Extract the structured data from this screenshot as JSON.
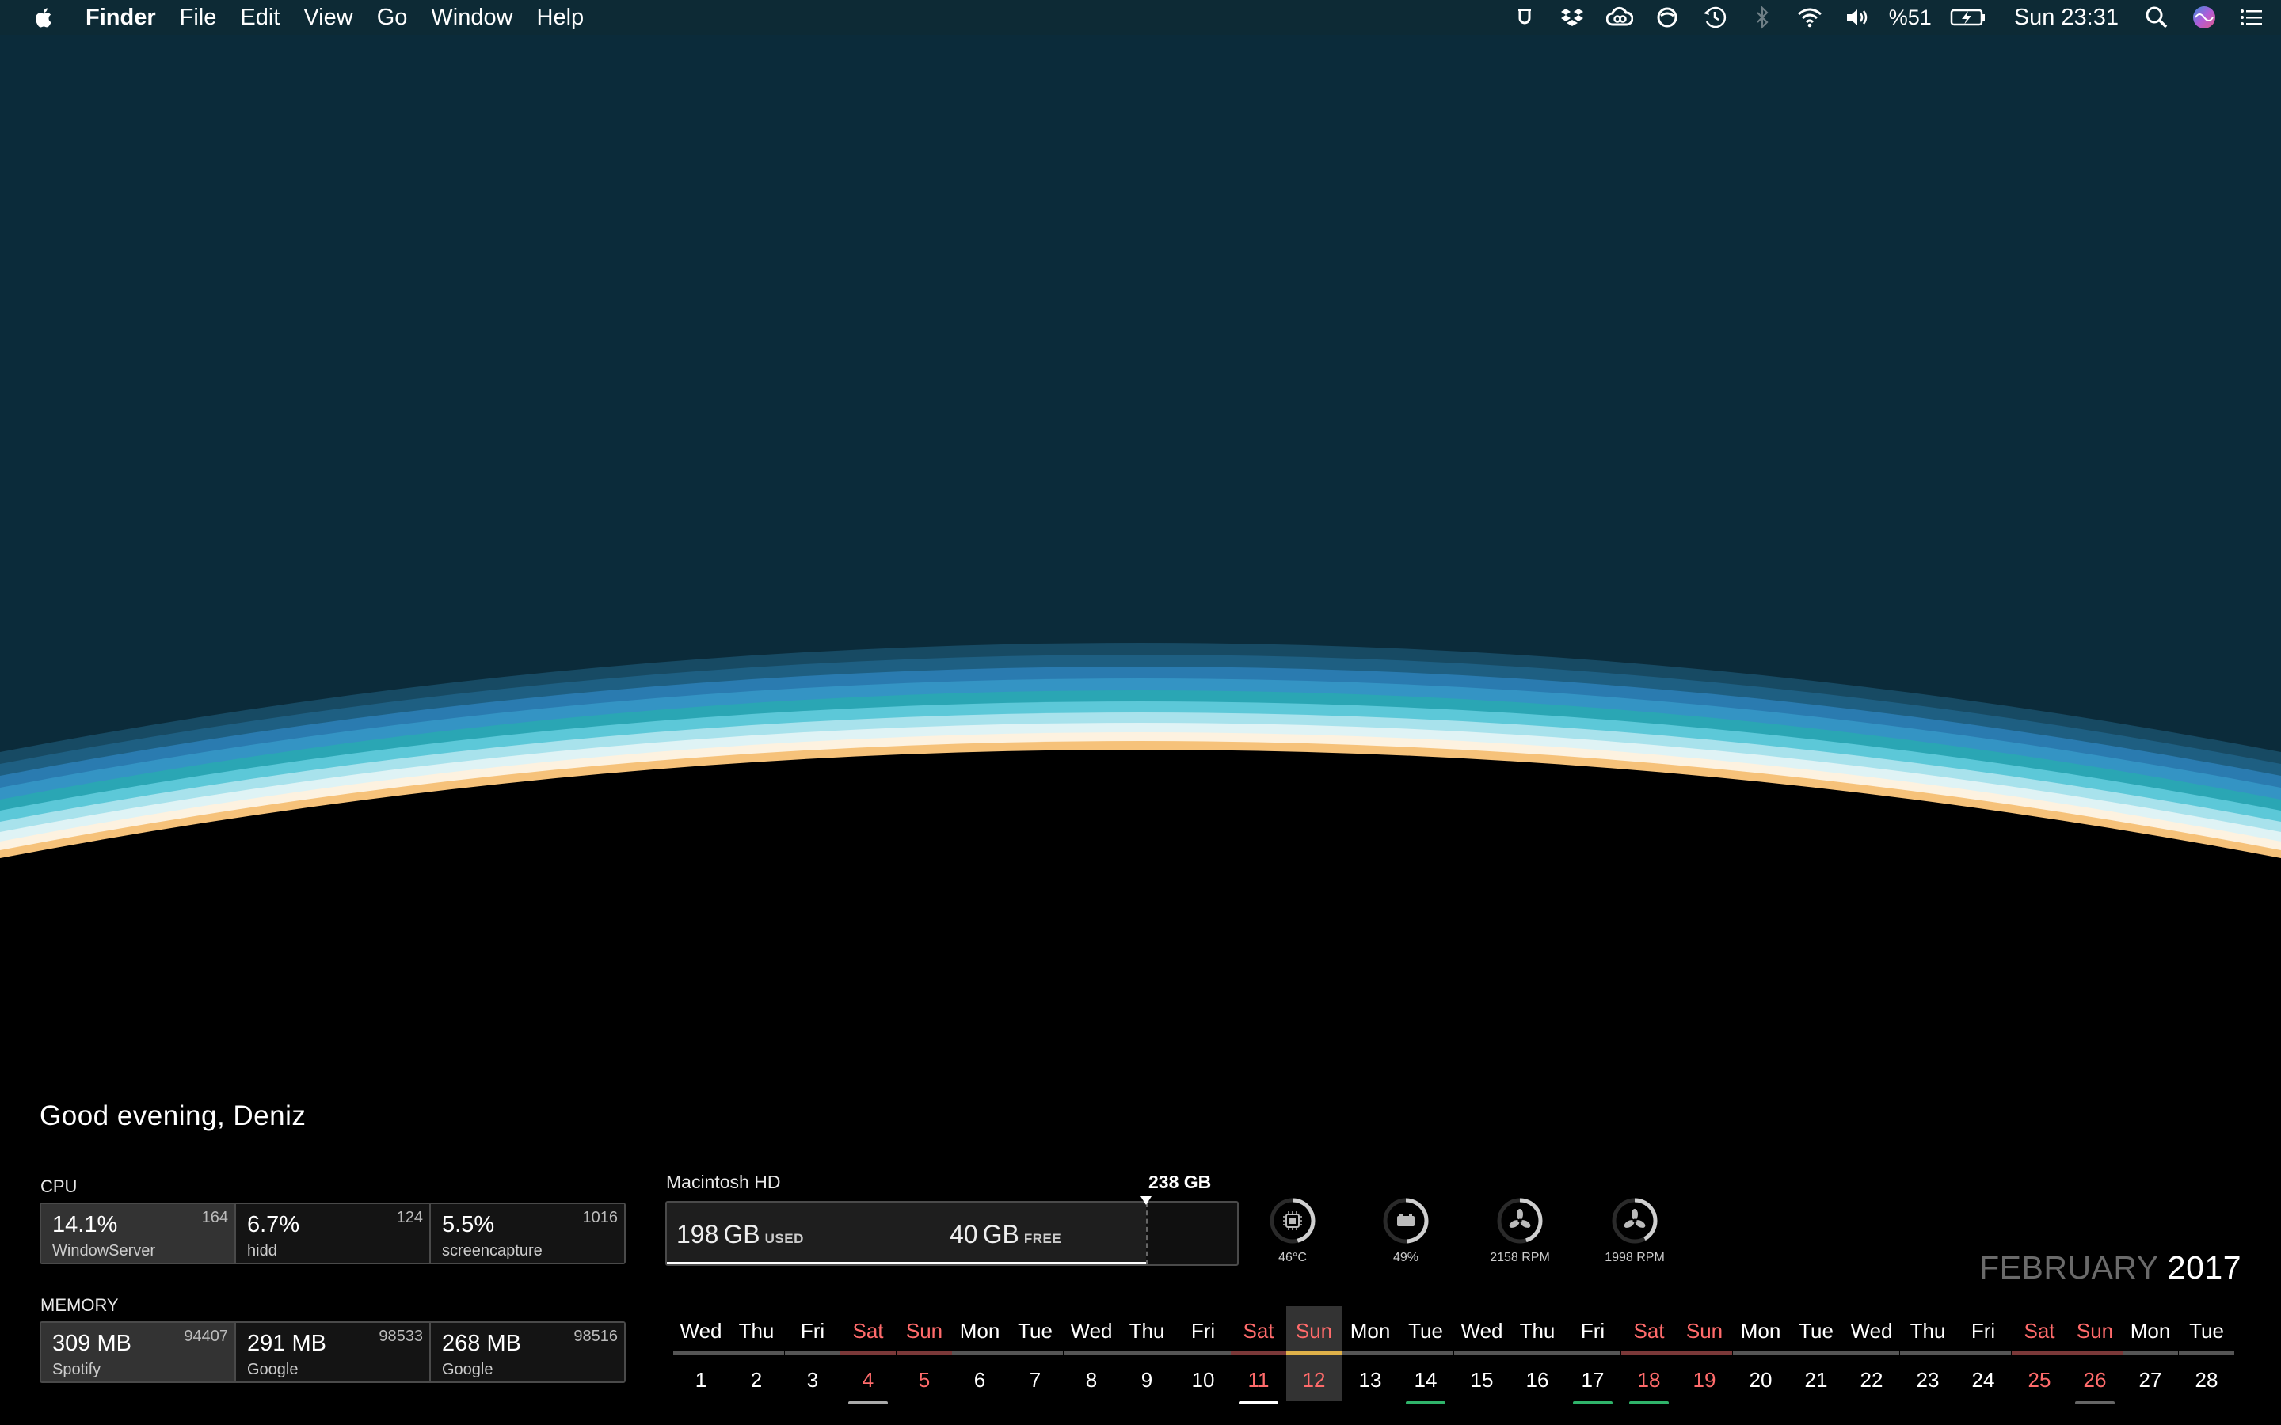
{
  "menubar": {
    "app_name": "Finder",
    "menus": [
      "File",
      "Edit",
      "View",
      "Go",
      "Window",
      "Help"
    ],
    "battery_percent": "%51",
    "clock": "Sun 23:31",
    "status_icons": [
      "umbrella-icon",
      "dropbox-icon",
      "creative-cloud-icon",
      "sync-icon",
      "time-machine-icon",
      "bluetooth-icon",
      "wifi-icon",
      "volume-icon",
      "battery-charging-icon",
      "search-icon",
      "siri-icon",
      "notification-center-icon"
    ]
  },
  "greeting": "Good evening, Deniz",
  "cpu": {
    "label": "CPU",
    "processes": [
      {
        "value": "14.1%",
        "name": "WindowServer",
        "pid": "164"
      },
      {
        "value": "6.7%",
        "name": "hidd",
        "pid": "124"
      },
      {
        "value": "5.5%",
        "name": "screencapture",
        "pid": "1016"
      }
    ]
  },
  "memory": {
    "label": "MEMORY",
    "processes": [
      {
        "value": "309 MB",
        "name": "Spotify",
        "pid": "94407"
      },
      {
        "value": "291 MB",
        "name": "Google",
        "pid": "98533"
      },
      {
        "value": "268 MB",
        "name": "Google",
        "pid": "98516"
      }
    ]
  },
  "disk": {
    "name": "Macintosh HD",
    "total": "238 GB",
    "used_value": "198",
    "used_unit": "GB",
    "used_label": "USED",
    "free_value": "40",
    "free_unit": "GB",
    "free_label": "FREE",
    "used_fraction": 0.84
  },
  "gauges": [
    {
      "icon": "cpu-chip-icon",
      "label": "46°C",
      "level": 0.46
    },
    {
      "icon": "battery-icon",
      "label": "49%",
      "level": 0.49
    },
    {
      "icon": "fan-icon",
      "label": "2158 RPM",
      "level": 0.45
    },
    {
      "icon": "fan-icon",
      "label": "1998 RPM",
      "level": 0.42
    }
  ],
  "calendar": {
    "month": "FEBRUARY",
    "year": "2017",
    "today": 12,
    "days": [
      {
        "dow": "Wed",
        "num": "1"
      },
      {
        "dow": "Thu",
        "num": "2"
      },
      {
        "dow": "Fri",
        "num": "3"
      },
      {
        "dow": "Sat",
        "num": "4",
        "weekend": true
      },
      {
        "dow": "Sun",
        "num": "5",
        "weekend": true
      },
      {
        "dow": "Mon",
        "num": "6"
      },
      {
        "dow": "Tue",
        "num": "7"
      },
      {
        "dow": "Wed",
        "num": "8"
      },
      {
        "dow": "Thu",
        "num": "9"
      },
      {
        "dow": "Fri",
        "num": "10"
      },
      {
        "dow": "Sat",
        "num": "11",
        "weekend": true
      },
      {
        "dow": "Sun",
        "num": "12",
        "weekend": true
      },
      {
        "dow": "Mon",
        "num": "13"
      },
      {
        "dow": "Tue",
        "num": "14"
      },
      {
        "dow": "Wed",
        "num": "15"
      },
      {
        "dow": "Thu",
        "num": "16"
      },
      {
        "dow": "Fri",
        "num": "17"
      },
      {
        "dow": "Sat",
        "num": "18",
        "weekend": true
      },
      {
        "dow": "Sun",
        "num": "19",
        "weekend": true
      },
      {
        "dow": "Mon",
        "num": "20"
      },
      {
        "dow": "Tue",
        "num": "21"
      },
      {
        "dow": "Wed",
        "num": "22"
      },
      {
        "dow": "Thu",
        "num": "23"
      },
      {
        "dow": "Fri",
        "num": "24"
      },
      {
        "dow": "Sat",
        "num": "25",
        "weekend": true
      },
      {
        "dow": "Sun",
        "num": "26",
        "weekend": true
      },
      {
        "dow": "Mon",
        "num": "27"
      },
      {
        "dow": "Tue",
        "num": "28"
      }
    ],
    "events": [
      {
        "day": 4,
        "color": "#aaaaaa"
      },
      {
        "day": 11,
        "color": "#ffffff"
      },
      {
        "day": 14,
        "color": "#2fb36a"
      },
      {
        "day": 17,
        "color": "#2fb36a"
      },
      {
        "day": 18,
        "color": "#2fb36a"
      },
      {
        "day": 26,
        "color": "#666666"
      }
    ]
  },
  "colors": {
    "menubar_bg": "#0d2a35",
    "sky": "#0b2b3a",
    "weekend": "#ff6b6b",
    "today_accent": "#e0b24a"
  }
}
